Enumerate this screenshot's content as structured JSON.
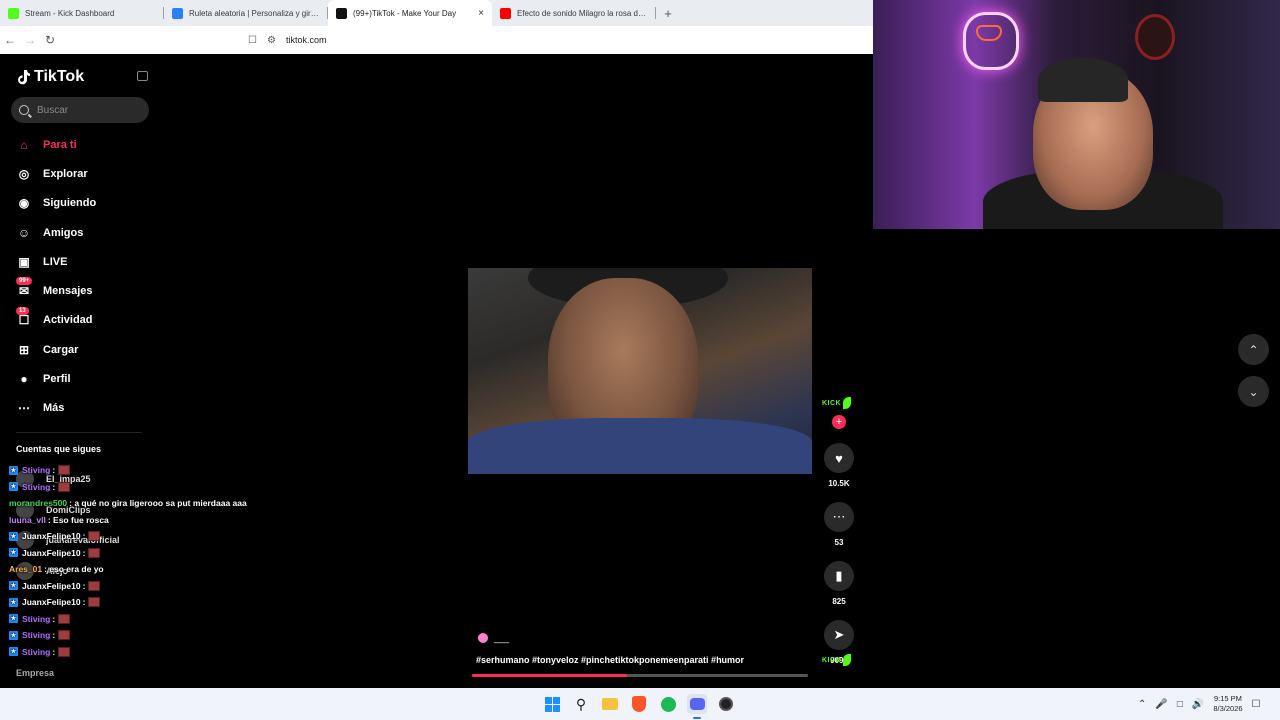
{
  "browser": {
    "tabs": [
      {
        "title": "Stream - Kick Dashboard",
        "favicon_color": "#53fc18"
      },
      {
        "title": "Ruleta aleatoria | Personaliza y gira tu",
        "favicon_color": "#2d7ff9"
      },
      {
        "title": "(99+)TikTok - Make Your Day",
        "favicon_color": "#111111",
        "active": true
      },
      {
        "title": "Efecto de sonido Milagro la rosa de Gu",
        "favicon_color": "#ff0000"
      }
    ],
    "url": "tiktok.com"
  },
  "tiktok": {
    "logo_text": "TikTok",
    "search_placeholder": "Buscar",
    "nav": [
      {
        "label": "Para ti",
        "icon": "home-icon"
      },
      {
        "label": "Explorar",
        "icon": "compass-icon"
      },
      {
        "label": "Siguiendo",
        "icon": "following-icon"
      },
      {
        "label": "Amigos",
        "icon": "friends-icon"
      },
      {
        "label": "LIVE",
        "icon": "live-icon"
      },
      {
        "label": "Mensajes",
        "icon": "messages-icon",
        "badge": "99+"
      },
      {
        "label": "Actividad",
        "icon": "activity-icon",
        "badge": "13"
      },
      {
        "label": "Cargar",
        "icon": "upload-icon"
      },
      {
        "label": "Perfil",
        "icon": "profile-icon"
      },
      {
        "label": "Más",
        "icon": "more-icon"
      }
    ],
    "following_title": "Cuentas que sigues",
    "following": [
      "El_impa25",
      "DomiClips",
      "juanarevalofficial",
      "Alejo"
    ],
    "footer": "Empresa",
    "video": {
      "caption_user": "___",
      "hashtags": "#serhumano #tonyveloz #pinchetiktokponemeenparati #humor",
      "progress": 0.46
    },
    "actions": {
      "likes": "10.5K",
      "comments": "53",
      "saves": "825",
      "shares": "9095"
    },
    "kick_text": "KICK"
  },
  "chat": [
    {
      "user": "Stiving",
      "msg": ":",
      "color": "#b26cff",
      "emote": true
    },
    {
      "user": "Stiving",
      "msg": ":",
      "color": "#b26cff",
      "emote": true
    },
    {
      "user": "morandres500",
      "msg": ": a qué no gira ligerooo sa put mierdaaa aaa",
      "color": "#3fd35a"
    },
    {
      "user": "luuna_vll",
      "msg": ": Eso fue rosca",
      "color": "#c77dff"
    },
    {
      "user": "JuanxFelipe10",
      "msg": ":",
      "color": "#ffffff",
      "emote": true
    },
    {
      "user": "JuanxFelipe10",
      "msg": ":",
      "color": "#ffffff",
      "emote": true
    },
    {
      "user": "Ares_01",
      "msg": ": eso era de yo",
      "color": "#ffb347"
    },
    {
      "user": "JuanxFelipe10",
      "msg": ":",
      "color": "#ffffff",
      "emote": true
    },
    {
      "user": "JuanxFelipe10",
      "msg": ":",
      "color": "#ffffff",
      "emote": true
    },
    {
      "user": "Stiving",
      "msg": ":",
      "color": "#b26cff",
      "emote": true
    },
    {
      "user": "Stiving",
      "msg": ":",
      "color": "#b26cff",
      "emote": true
    },
    {
      "user": "Stiving",
      "msg": ":",
      "color": "#b26cff",
      "emote": true
    }
  ],
  "taskbar": {
    "time": "9:15 PM",
    "date": "8/3/2026"
  }
}
